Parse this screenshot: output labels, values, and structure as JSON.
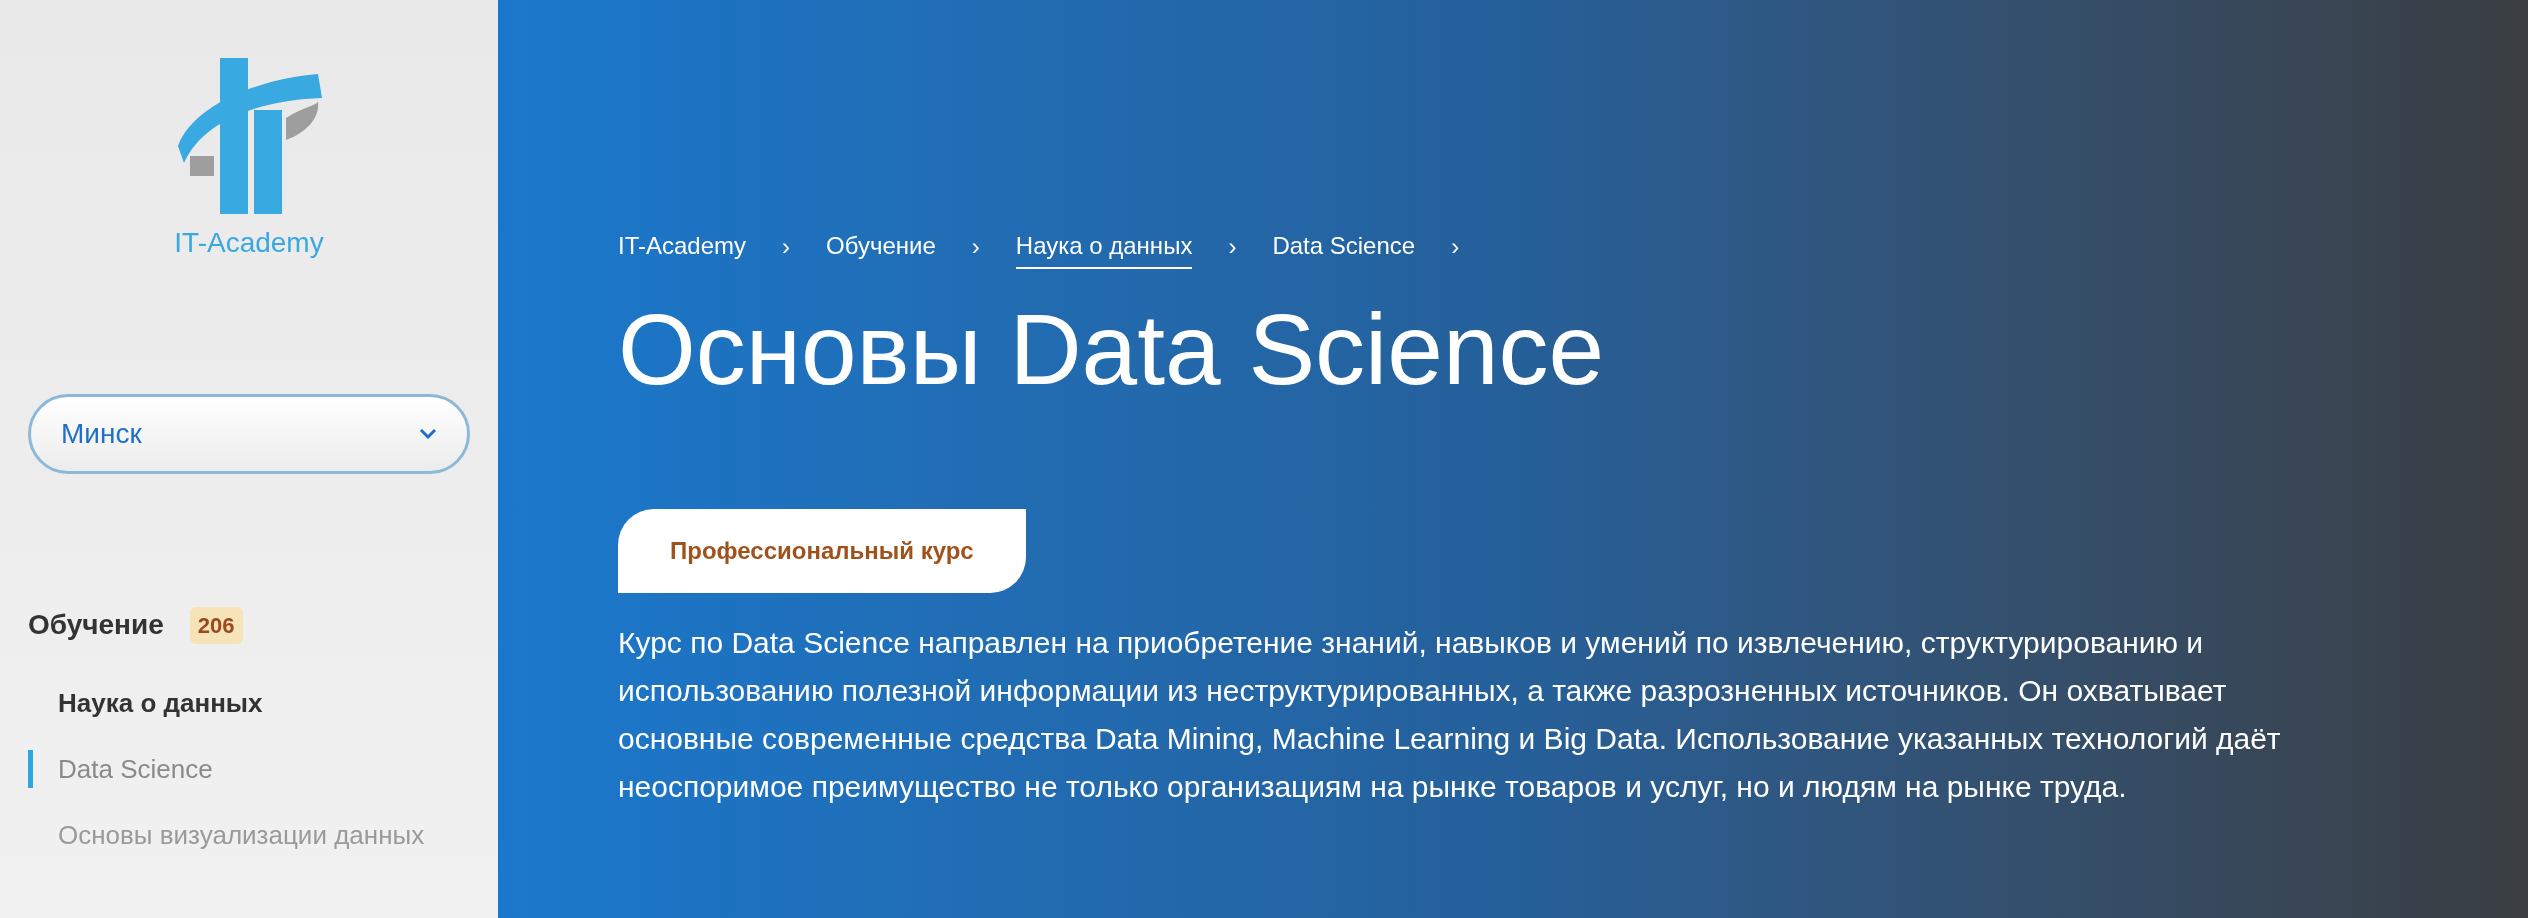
{
  "sidebar": {
    "logo_text": "IT-Academy",
    "city_select": {
      "value": "Минск"
    },
    "section": {
      "title": "Обучение",
      "count": "206"
    },
    "items": [
      {
        "label": "Наука о данных",
        "kind": "heading",
        "selected": false
      },
      {
        "label": "Data Science",
        "kind": "link",
        "selected": true
      },
      {
        "label": "Основы визуализации данных",
        "kind": "link",
        "selected": false
      }
    ]
  },
  "breadcrumbs": [
    {
      "label": "IT-Academy",
      "underlined": false,
      "separator": "›"
    },
    {
      "label": "Обучение",
      "underlined": false,
      "separator": "›"
    },
    {
      "label": "Наука о данных",
      "underlined": true,
      "separator": "›"
    },
    {
      "label": "Data Science",
      "underlined": false,
      "separator": "›"
    }
  ],
  "title": "Основы Data Science",
  "badge": "Профессиональный курс",
  "description": "Курс по Data Science направлен на приобретение знаний, навыков и умений по извлечению, структурированию и использованию полезной информации из неструктурированных, а также разрозненных источников. Он охватывает основные современные средства Data Mining, Machine Learning и Big Data. Использование указанных технологий даёт неоспоримое преимущество не только организациям на рынке товаров и услуг, но и людям на рынке труда."
}
